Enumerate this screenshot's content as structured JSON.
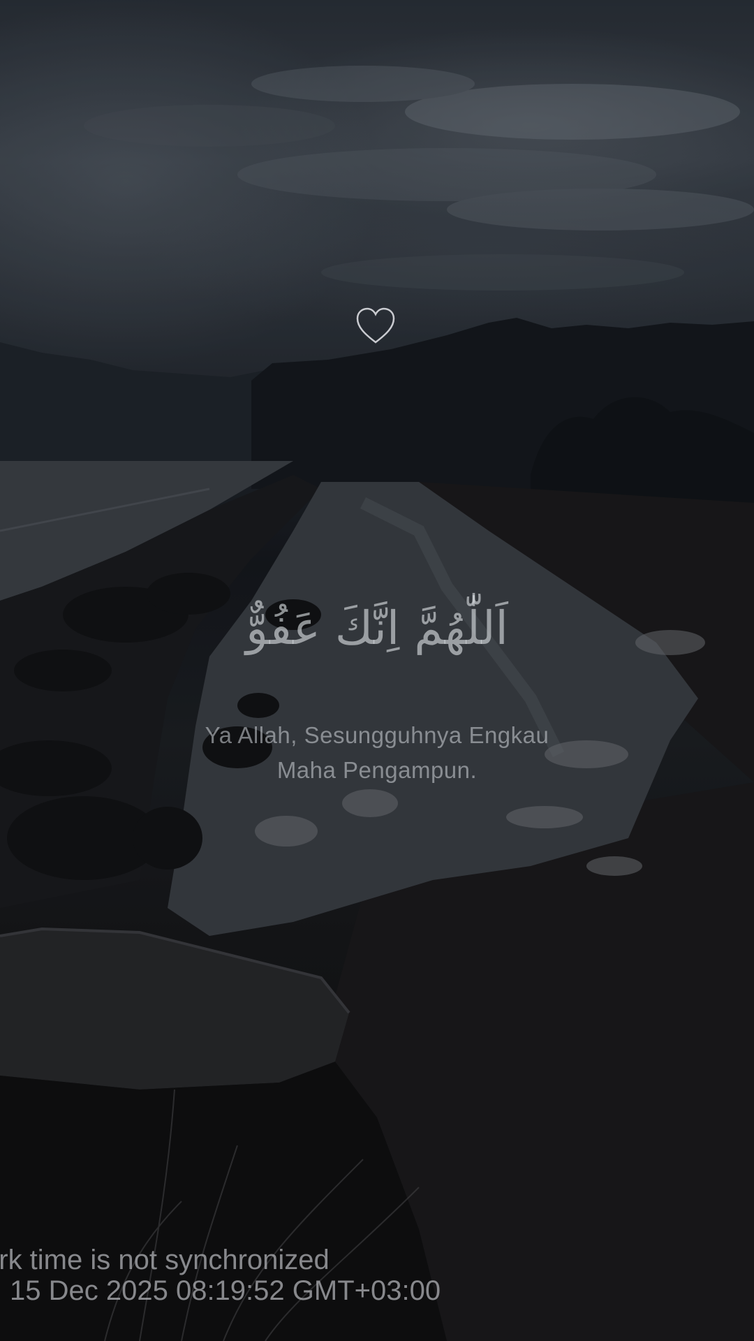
{
  "overlay": {
    "icon": "heart-outline-icon",
    "arabic_text": "اَللّٰهُمَّ اِنَّكَ عَفُوٌّ",
    "translation_line1": "Ya Allah, Sesungguhnya Engkau",
    "translation_line2": "Maha Pengampun."
  },
  "watermark": {
    "line1": "ork time is not synchronized",
    "line2": "15 Dec 2025 08:19:52 GMT+03:00"
  },
  "colors": {
    "text_overlay": "#dce0e4",
    "watermark_text": "#aaacb0"
  }
}
